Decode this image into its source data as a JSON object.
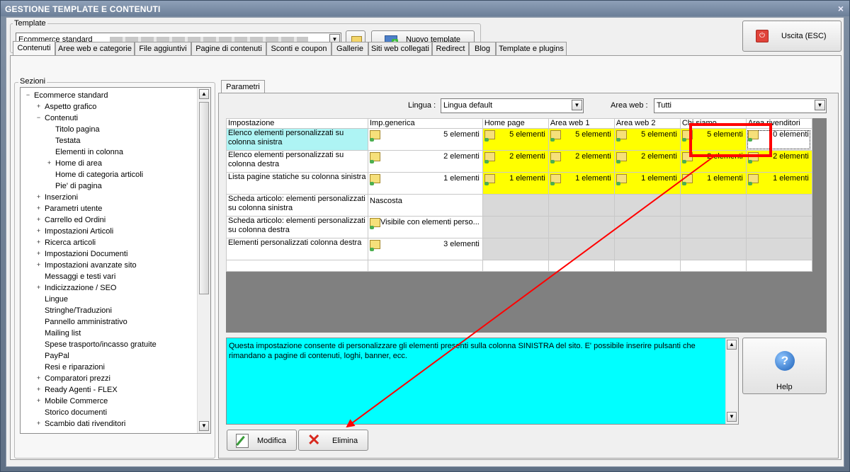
{
  "window": {
    "title": "GESTIONE TEMPLATE E CONTENUTI",
    "close_glyph": "×"
  },
  "template_group": {
    "label": "Template",
    "value": "Ecommerce standard",
    "new_button": "Nuovo template"
  },
  "exit_button": "Uscita (ESC)",
  "tabs": [
    "Contenuti",
    "Aree web e categorie",
    "File aggiuntivi",
    "Pagine di contenuti",
    "Sconti e coupon",
    "Gallerie",
    "Siti web collegati",
    "Redirect",
    "Blog",
    "Template e plugins"
  ],
  "sections": {
    "label": "Sezioni",
    "items": [
      {
        "label": "Ecommerce standard",
        "expander": "−"
      },
      {
        "label": "Aspetto grafico",
        "expander": "+"
      },
      {
        "label": "Contenuti",
        "expander": "−"
      },
      {
        "label": "Titolo pagina",
        "expander": ""
      },
      {
        "label": "Testata",
        "expander": ""
      },
      {
        "label": "Elementi in colonna",
        "expander": ""
      },
      {
        "label": "Home di area",
        "expander": "+"
      },
      {
        "label": "Home di categoria articoli",
        "expander": ""
      },
      {
        "label": "Pie' di pagina",
        "expander": ""
      },
      {
        "label": "Inserzioni",
        "expander": "+"
      },
      {
        "label": "Parametri utente",
        "expander": "+"
      },
      {
        "label": "Carrello ed Ordini",
        "expander": "+"
      },
      {
        "label": "Impostazioni Articoli",
        "expander": "+"
      },
      {
        "label": "Ricerca articoli",
        "expander": "+"
      },
      {
        "label": "Impostazioni Documenti",
        "expander": "+"
      },
      {
        "label": "Impostazioni avanzate sito",
        "expander": "+"
      },
      {
        "label": "Messaggi e testi vari",
        "expander": ""
      },
      {
        "label": "Indicizzazione / SEO",
        "expander": "+"
      },
      {
        "label": "Lingue",
        "expander": ""
      },
      {
        "label": "Stringhe/Traduzioni",
        "expander": ""
      },
      {
        "label": "Pannello amministrativo",
        "expander": ""
      },
      {
        "label": "Mailing list",
        "expander": ""
      },
      {
        "label": "Spese trasporto/incasso gratuite",
        "expander": ""
      },
      {
        "label": "PayPal",
        "expander": ""
      },
      {
        "label": "Resi e riparazioni",
        "expander": ""
      },
      {
        "label": "Comparatori prezzi",
        "expander": "+"
      },
      {
        "label": "Ready Agenti - FLEX",
        "expander": "+"
      },
      {
        "label": "Mobile Commerce",
        "expander": "+"
      },
      {
        "label": "Storico documenti",
        "expander": ""
      },
      {
        "label": "Scambio dati rivenditori",
        "expander": "+"
      }
    ]
  },
  "params": {
    "tab": "Parametri",
    "lingua_label": "Lingua :",
    "lingua_value": "Lingua default",
    "area_label": "Area web :",
    "area_value": "Tutti"
  },
  "grid": {
    "headers": [
      "Impostazione",
      "Imp.generica",
      "Home page",
      "Area web 1",
      "Area web 2",
      "Chi siamo",
      "Area rivenditori"
    ],
    "rows": [
      {
        "name": "Elenco elementi personalizzati su colonna sinistra",
        "generic": "5 elementi",
        "cells": [
          "5 elementi",
          "5 elementi",
          "5 elementi",
          "5 elementi",
          "0 elementi"
        ]
      },
      {
        "name": "Elenco elementi personalizzati su colonna destra",
        "generic": "2 elementi",
        "cells": [
          "2 elementi",
          "2 elementi",
          "2 elementi",
          "2 elementi",
          "2 elementi"
        ]
      },
      {
        "name": "Lista pagine statiche su colonna sinistra",
        "generic": "1 elementi",
        "cells": [
          "1 elementi",
          "1 elementi",
          "1 elementi",
          "1 elementi",
          "1 elementi"
        ]
      },
      {
        "name": "Scheda articolo: elementi personalizzati su colonna sinistra",
        "generic": "Nascosta",
        "cells": [
          "",
          "",
          "",
          "",
          ""
        ]
      },
      {
        "name": "Scheda articolo: elementi personalizzati su colonna destra",
        "generic": "Visibile con elementi perso...",
        "cells": [
          "",
          "",
          "",
          "",
          ""
        ]
      },
      {
        "name": "Elementi personalizzati colonna destra",
        "generic": "3 elementi",
        "cells": [
          "",
          "",
          "",
          "",
          ""
        ]
      }
    ]
  },
  "description": "Questa impostazione consente di personalizzare gli elementi presenti sulla colonna SINISTRA del sito. E' possibile inserire pulsanti che rimandano a pagine di contenuti, loghi, banner, ecc.",
  "buttons": {
    "help": "Help",
    "help_glyph": "?",
    "modify": "Modifica",
    "delete": "Elimina"
  },
  "colors": {
    "highlight": "#ffff00",
    "description_bg": "#00ffff",
    "annotation": "#ff0000",
    "selected_row": "#aef4f4"
  }
}
